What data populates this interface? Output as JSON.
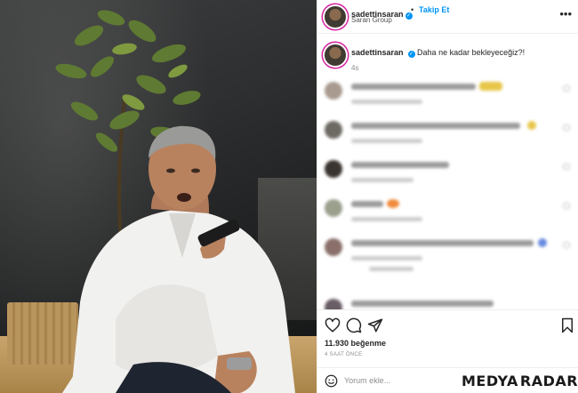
{
  "post": {
    "image_alt": "photo",
    "colors": {
      "link": "#0095f6",
      "text": "#262626",
      "muted": "#8e8e8e",
      "story_ring": "#d6249f"
    }
  },
  "header": {
    "username": "sadettinsaran",
    "verified_icon": "verified-badge-icon",
    "separator": "•",
    "follow_label": "Takip Et",
    "subtitle": "Saran Group",
    "more_icon": "more-options-icon"
  },
  "caption": {
    "username": "sadettinsaran",
    "text": "Daha ne kadar bekleyeceğiz?!",
    "time": "4s"
  },
  "actions": {
    "icons": [
      "heart-icon",
      "comment-icon",
      "share-icon",
      "bookmark-icon"
    ],
    "likes": "11.930 beğenme",
    "posted": "4 SAAT ÖNCE"
  },
  "comment_bar": {
    "emoji_icon": "emoji-icon",
    "placeholder": "Yorum ekle..."
  },
  "watermark": {
    "left": "MEDYA",
    "right": "RADAR",
    "color": "#e3241b"
  }
}
